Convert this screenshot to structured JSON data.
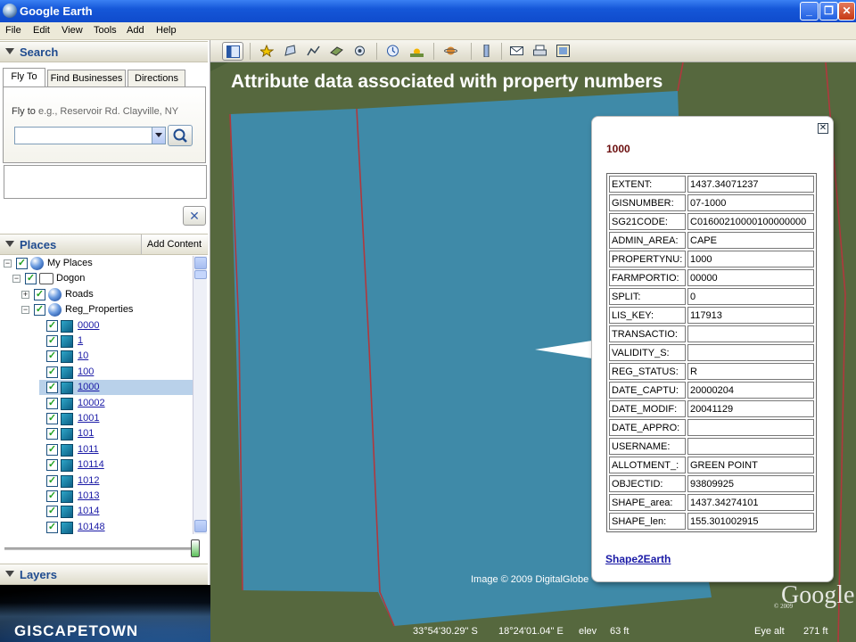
{
  "window": {
    "title": "Google Earth",
    "buttons": [
      "_",
      "❐",
      "✕"
    ]
  },
  "menu": [
    "File",
    "Edit",
    "View",
    "Tools",
    "Add",
    "Help"
  ],
  "search": {
    "header": "Search",
    "tabs": [
      "Fly To",
      "Find Businesses",
      "Directions"
    ],
    "fly_to_label": "Fly to",
    "fly_to_hint": "e.g., Reservoir Rd. Clayville, NY",
    "fly_to_value": "",
    "clear_label": "✕"
  },
  "places": {
    "header": "Places",
    "add_content": "Add Content",
    "tree": [
      {
        "label": "My Places",
        "icon": "globe-icon",
        "level": 0,
        "expander": "−",
        "checked": true,
        "link": false
      },
      {
        "label": "Dogon",
        "icon": "folder-icon",
        "level": 1,
        "expander": "−",
        "checked": true,
        "link": false
      },
      {
        "label": "Roads",
        "icon": "globe-icon",
        "level": 2,
        "expander": "+",
        "checked": true,
        "link": false
      },
      {
        "label": "Reg_Properties",
        "icon": "globe-icon",
        "level": 2,
        "expander": "−",
        "checked": true,
        "link": false
      },
      {
        "label": "0000",
        "icon": "polygon-icon",
        "level": 3,
        "checked": true,
        "link": true
      },
      {
        "label": "1",
        "icon": "polygon-icon",
        "level": 3,
        "checked": true,
        "link": true
      },
      {
        "label": "10",
        "icon": "polygon-icon",
        "level": 3,
        "checked": true,
        "link": true
      },
      {
        "label": "100",
        "icon": "polygon-icon",
        "level": 3,
        "checked": true,
        "link": true
      },
      {
        "label": "1000",
        "icon": "polygon-icon",
        "level": 3,
        "checked": true,
        "link": true,
        "selected": true
      },
      {
        "label": "10002",
        "icon": "polygon-icon",
        "level": 3,
        "checked": true,
        "link": true
      },
      {
        "label": "1001",
        "icon": "polygon-icon",
        "level": 3,
        "checked": true,
        "link": true
      },
      {
        "label": "101",
        "icon": "polygon-icon",
        "level": 3,
        "checked": true,
        "link": true
      },
      {
        "label": "1011",
        "icon": "polygon-icon",
        "level": 3,
        "checked": true,
        "link": true
      },
      {
        "label": "10114",
        "icon": "polygon-icon",
        "level": 3,
        "checked": true,
        "link": true
      },
      {
        "label": "1012",
        "icon": "polygon-icon",
        "level": 3,
        "checked": true,
        "link": true
      },
      {
        "label": "1013",
        "icon": "polygon-icon",
        "level": 3,
        "checked": true,
        "link": true
      },
      {
        "label": "1014",
        "icon": "polygon-icon",
        "level": 3,
        "checked": true,
        "link": true
      },
      {
        "label": "10148",
        "icon": "polygon-icon",
        "level": 3,
        "checked": true,
        "link": true
      }
    ]
  },
  "layers": {
    "header": "Layers"
  },
  "banner": {
    "logo": "GISCAPETOWN"
  },
  "toolbar": {
    "icons": [
      "sidebar-toggle-icon",
      "add-placemark-icon",
      "add-polygon-icon",
      "add-path-icon",
      "add-image-overlay-icon",
      "record-tour-icon",
      "historical-imagery-icon",
      "sunlight-icon",
      "switch-to-sky-icon",
      "ruler-icon",
      "email-icon",
      "print-icon",
      "view-in-maps-icon"
    ]
  },
  "map": {
    "title": "Attribute data associated with property numbers",
    "copyright": "Image © 2009 DigitalGlobe",
    "logo": "Google",
    "logo_year": "© 2009",
    "status": {
      "lat": "33°54'30.29\" S",
      "lon": "18°24'01.04\" E",
      "elev_label": "elev",
      "elev_value": "63 ft",
      "eye_label": "Eye alt",
      "eye_value": "271 ft"
    },
    "colors": {
      "parcel_fill": "#3f8aa8",
      "boundary": "#b0383d"
    }
  },
  "balloon": {
    "title": "1000",
    "link": "Shape2Earth",
    "attributes": [
      {
        "key": "EXTENT:",
        "value": "1437.34071237"
      },
      {
        "key": "GISNUMBER:",
        "value": "07-1000"
      },
      {
        "key": "SG21CODE:",
        "value": "C01600210000100000000"
      },
      {
        "key": "ADMIN_AREA:",
        "value": "CAPE"
      },
      {
        "key": "PROPERTYNU:",
        "value": "1000"
      },
      {
        "key": "FARMPORTIO:",
        "value": "00000"
      },
      {
        "key": "SPLIT:",
        "value": "0"
      },
      {
        "key": "LIS_KEY:",
        "value": "117913"
      },
      {
        "key": "TRANSACTIO:",
        "value": ""
      },
      {
        "key": "VALIDITY_S:",
        "value": ""
      },
      {
        "key": "REG_STATUS:",
        "value": "R"
      },
      {
        "key": "DATE_CAPTU:",
        "value": "20000204"
      },
      {
        "key": "DATE_MODIF:",
        "value": "20041129"
      },
      {
        "key": "DATE_APPRO:",
        "value": ""
      },
      {
        "key": "USERNAME:",
        "value": ""
      },
      {
        "key": "ALLOTMENT_:",
        "value": "GREEN POINT"
      },
      {
        "key": "OBJECTID:",
        "value": "93809925"
      },
      {
        "key": "SHAPE_area:",
        "value": "1437.34274101"
      },
      {
        "key": "SHAPE_len:",
        "value": "155.301002915"
      }
    ]
  }
}
